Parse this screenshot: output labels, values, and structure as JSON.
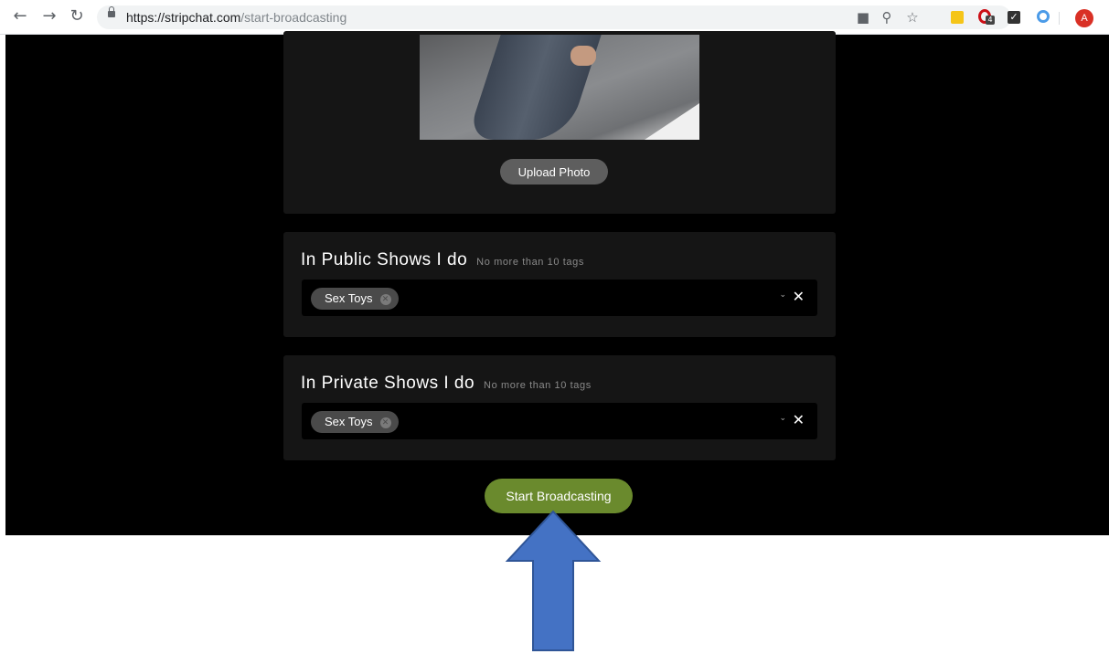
{
  "browser": {
    "url_domain": "https://stripchat.com",
    "url_path": "/start-broadcasting",
    "extension_badge": "4",
    "profile_initial": "A"
  },
  "photo_section": {
    "upload_label": "Upload Photo"
  },
  "public_shows": {
    "title": "In Public Shows I do",
    "hint": "No more than 10 tags",
    "tags": [
      "Sex Toys"
    ]
  },
  "private_shows": {
    "title": "In Private Shows I do",
    "hint": "No more than 10 tags",
    "tags": [
      "Sex Toys"
    ]
  },
  "start_label": "Start Broadcasting",
  "colors": {
    "page_bg": "#000000",
    "card_bg": "#151515",
    "start_button": "#6a8a2d",
    "annotation_arrow": "#4472c4"
  }
}
